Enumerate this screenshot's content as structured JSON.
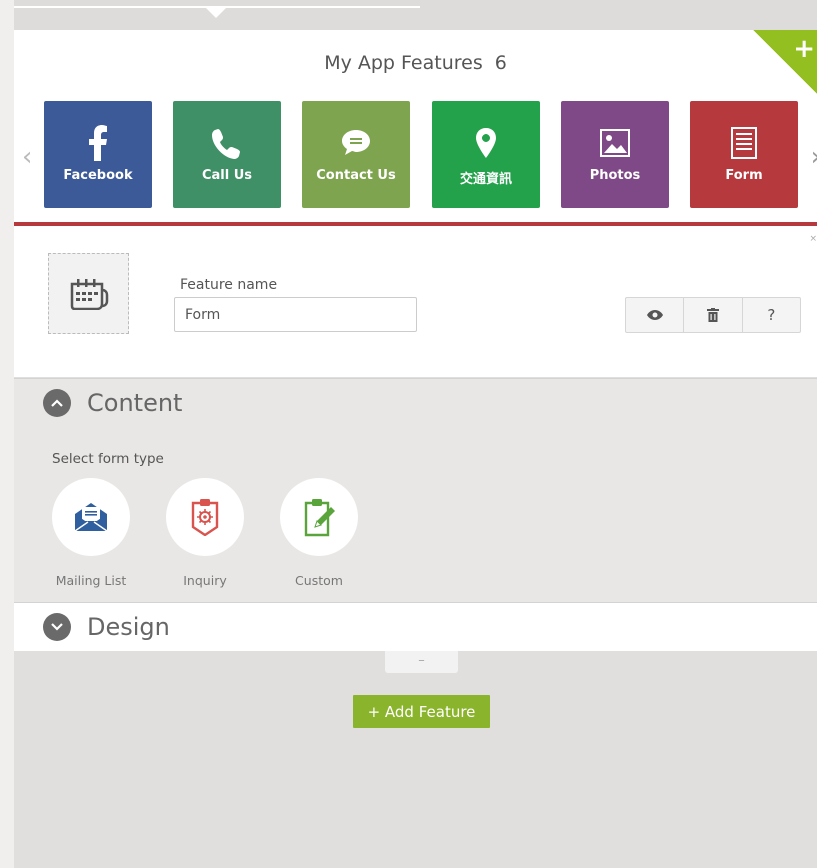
{
  "header": {
    "title": "My App Features",
    "count": "6",
    "add_icon": "plus-icon",
    "prev_icon": "chevron-left-icon",
    "next_icon": "chevron-right-icon"
  },
  "features": [
    {
      "label": "Facebook",
      "icon": "facebook-icon",
      "color": "#3d5a98"
    },
    {
      "label": "Call Us",
      "icon": "phone-icon",
      "color": "#3f9066"
    },
    {
      "label": "Contact Us",
      "icon": "chat-bubble-icon",
      "color": "#7fa44f"
    },
    {
      "label": "交通資訊",
      "icon": "map-pin-icon",
      "color": "#23a14b"
    },
    {
      "label": "Photos",
      "icon": "image-icon",
      "color": "#7f4886"
    },
    {
      "label": "Form",
      "icon": "form-icon",
      "color": "#b5393d",
      "active": true
    }
  ],
  "detail": {
    "feature_icon": "calendar-icon",
    "feature_name_label": "Feature name",
    "feature_name_value": "Form",
    "actions": [
      {
        "name": "preview",
        "icon": "eye-icon"
      },
      {
        "name": "delete",
        "icon": "trash-icon"
      },
      {
        "name": "help",
        "icon": "question-icon",
        "label": "?"
      }
    ]
  },
  "content": {
    "title": "Content",
    "toggle_icon": "chevron-up-icon",
    "select_label": "Select form type",
    "form_types": [
      {
        "label": "Mailing List",
        "icon": "envelope-icon",
        "color": "#2f5f9e"
      },
      {
        "label": "Inquiry",
        "icon": "clipboard-badge-icon",
        "color": "#d9534f"
      },
      {
        "label": "Custom",
        "icon": "clipboard-pencil-icon",
        "color": "#5aa43c"
      }
    ]
  },
  "design": {
    "title": "Design",
    "toggle_icon": "chevron-down-icon"
  },
  "collapse_label": "–",
  "add_feature_label": "+ Add Feature",
  "colors": {
    "accent_green": "#8ab42b",
    "active_red": "#b5393d"
  }
}
